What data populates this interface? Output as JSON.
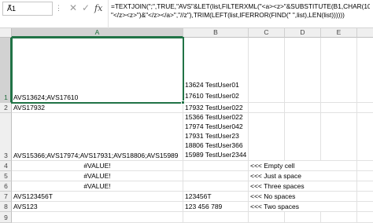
{
  "formula_bar": {
    "name_box": "A1",
    "dots": "⋮",
    "fx_label": "fx",
    "formula_lines": [
      "=TEXTJOIN(\";\",TRUE,\"AVS\"&LET(list,FILTERXML(\"<a><z>\"&SUBSTITUTE(B1,CHAR(10),",
      "\"</z><z>\")&\"</z></a>\",\"//z\"),TRIM(LEFT(list,IFERROR(FIND(\" \",list),LEN(list))))))"
    ]
  },
  "columns": [
    "A",
    "B",
    "C",
    "D",
    "E"
  ],
  "rows": [
    "1",
    "2",
    "3",
    "4",
    "5",
    "6",
    "7",
    "8",
    "9"
  ],
  "cells": {
    "A1": "AVS13624;AVS17610",
    "B1": [
      "13624 TestUser01",
      "17610 TestUser02"
    ],
    "A2": "AVS17932",
    "B2": "17932 TestUser022",
    "A3": "AVS15366;AVS17974;AVS17931;AVS18806;AVS15989",
    "B3": [
      "15366 TestUser022",
      "17974 TestUser042",
      "17931 TestUser23",
      "18806 TestUser366",
      "15989 TestUser2344"
    ],
    "A4": "#VALUE!",
    "C4": "<<< Empty cell",
    "A5": "#VALUE!",
    "C5": "<<< Just a space",
    "A6": "#VALUE!",
    "C6": "<<< Three spaces",
    "A7": "AVS123456T",
    "B7": "123456T",
    "C7": "<<< No spaces",
    "A8": "AVS123",
    "B8": "123 456 789",
    "C8": "<<< Two spaces"
  },
  "colors": {
    "selection": "#217346",
    "header_bg": "#efefef",
    "gridline": "#e1e1e1"
  }
}
